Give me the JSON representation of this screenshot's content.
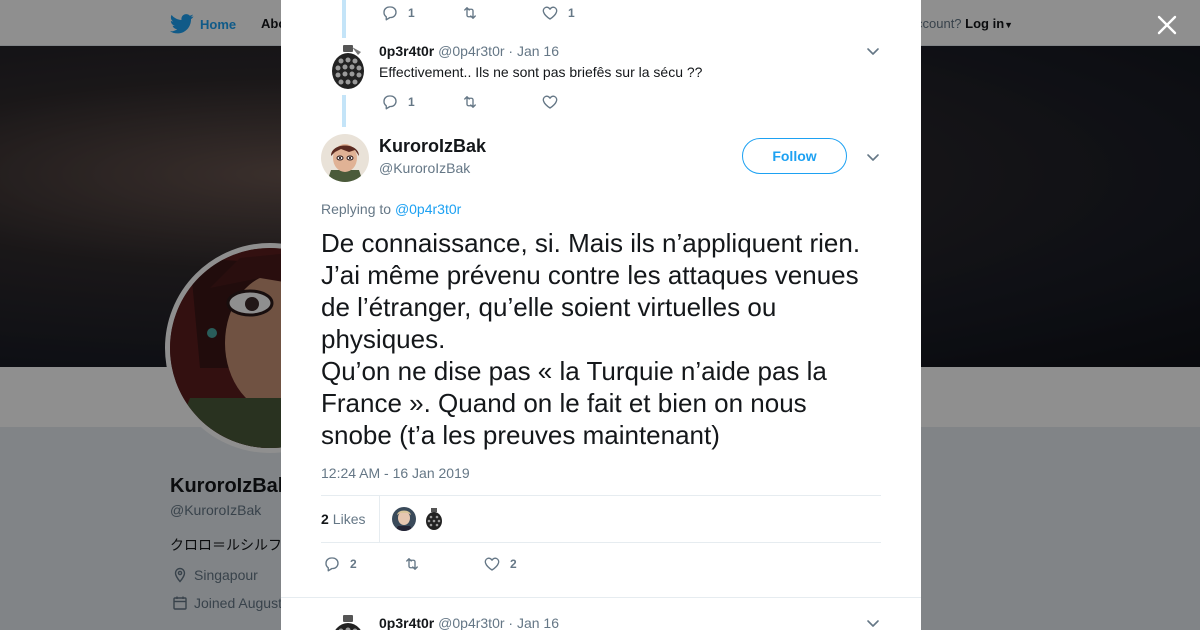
{
  "background_page": {
    "nav": {
      "home_label": "Home",
      "about_label": "Abo",
      "account_prompt": "ccount?",
      "login_label": "Log in"
    },
    "profile": {
      "name": "KuroroIzBak",
      "handle": "@KuroroIzBak",
      "bio": "クロロ＝ルシルフ",
      "location": "Singapour",
      "joined": "Joined August"
    }
  },
  "thread": {
    "prev_tweet_actions": {
      "replies": "1",
      "retweets": "",
      "likes": "1"
    },
    "reply_1": {
      "name": "0p3r4t0r",
      "handle": "@0p4r3t0r",
      "date": "· Jan 16",
      "text": "Effectivement.. Ils ne sont pas briefês sur la sécu ??",
      "replies": "1",
      "retweets": "",
      "likes": ""
    },
    "main_tweet": {
      "name": "KuroroIzBak",
      "handle": "@KuroroIzBak",
      "follow_label": "Follow",
      "replying_prefix": "Replying to",
      "replying_to": "@0p4r3t0r",
      "text": "De connaissance, si. Mais ils n’appliquent rien. J’ai même prévenu contre les attaques venues de l’étranger, qu’elle soient virtuelles ou physiques.\nQu’on ne dise pas « la Turquie n’aide pas la France ». Quand on le fait et bien on nous snobe (t’a les preuves maintenant)",
      "timestamp": "12:24 AM - 16 Jan 2019",
      "likes_count": "2",
      "likes_label": "Likes",
      "replies": "2",
      "retweets": "",
      "likes": "2"
    },
    "reply_2": {
      "name": "0p3r4t0r",
      "handle": "@0p4r3t0r",
      "date": "· Jan 16"
    }
  },
  "colors": {
    "twitter_blue": "#1da1f2",
    "text_primary": "#14171a",
    "text_secondary": "#657786",
    "thread_line": "#c4e4f8"
  }
}
